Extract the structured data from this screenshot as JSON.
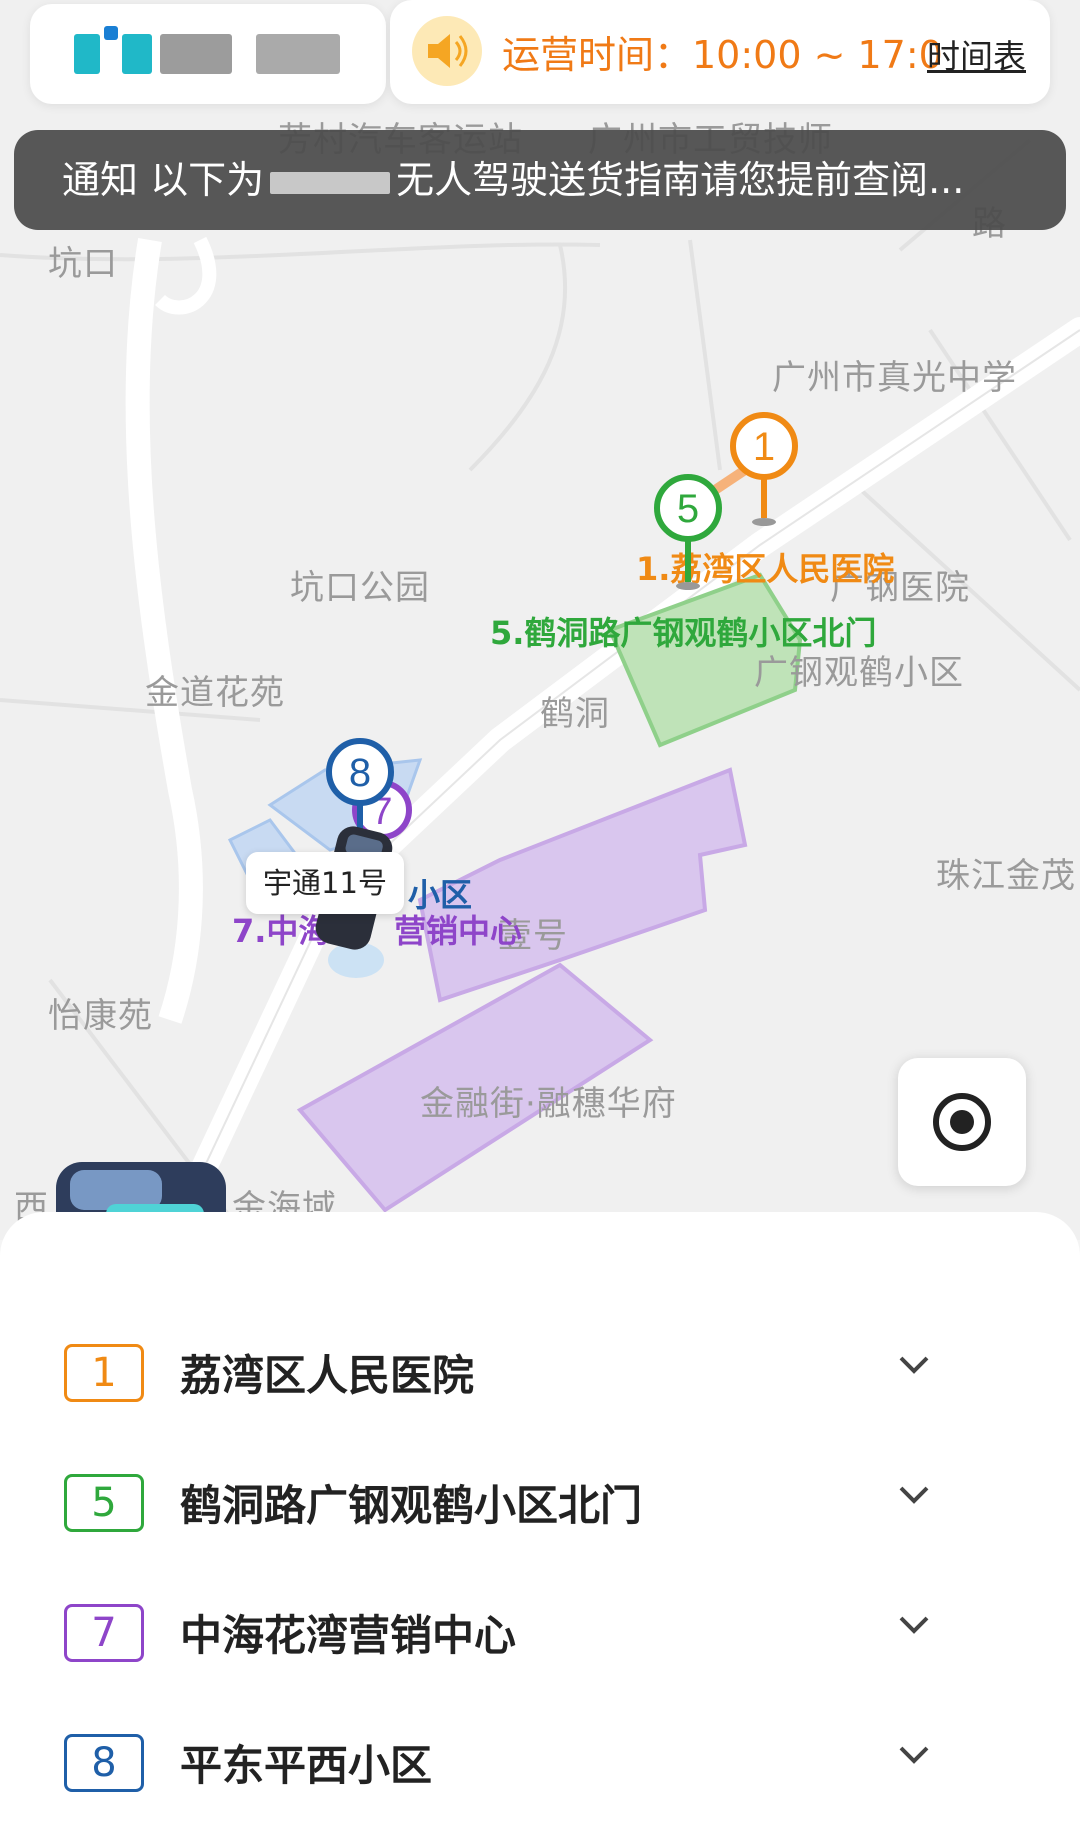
{
  "header": {
    "hours_text": "运营时间：10:00 ~ 17:0",
    "schedule_link": "时间表"
  },
  "notice": {
    "prefix": "通知  以下为",
    "suffix": "无人驾驶送货指南请您提前查阅..."
  },
  "map": {
    "place_labels": [
      "芳村汽车客运站",
      "广州市工贸技师",
      "坑口",
      "广州市真光中学",
      "坑口公园",
      "广钢医院",
      "金道花苑",
      "鹤洞",
      "广钢观鹤小区",
      "珠江金茂",
      "怡康苑",
      "金融街·融穗华府",
      "西",
      "金海域",
      "壹号",
      "路"
    ],
    "stop_labels": {
      "s1": "1.荔湾区人民医院",
      "s5": "5.鹤洞路广钢观鹤小区北门",
      "s7": "7.中海",
      "s7b": "营销中心",
      "s8": "小区"
    },
    "pins": {
      "p1": "1",
      "p5": "5",
      "p7": "7",
      "p8": "8"
    },
    "vehicle_name": "宇通11号"
  },
  "colors": {
    "stop1": "#f08a14",
    "stop5": "#2fa83c",
    "stop7": "#8e45c9",
    "stop8": "#1f5fa8"
  },
  "stops": [
    {
      "number": "1",
      "name": "荔湾区人民医院"
    },
    {
      "number": "5",
      "name": "鹤洞路广钢观鹤小区北门"
    },
    {
      "number": "7",
      "name": "中海花湾营销中心"
    },
    {
      "number": "8",
      "name": "平东平西小区"
    }
  ],
  "icons": {
    "speaker": "speaker-icon",
    "locate": "locate-target-icon",
    "chevron": "chevron-down-icon"
  }
}
